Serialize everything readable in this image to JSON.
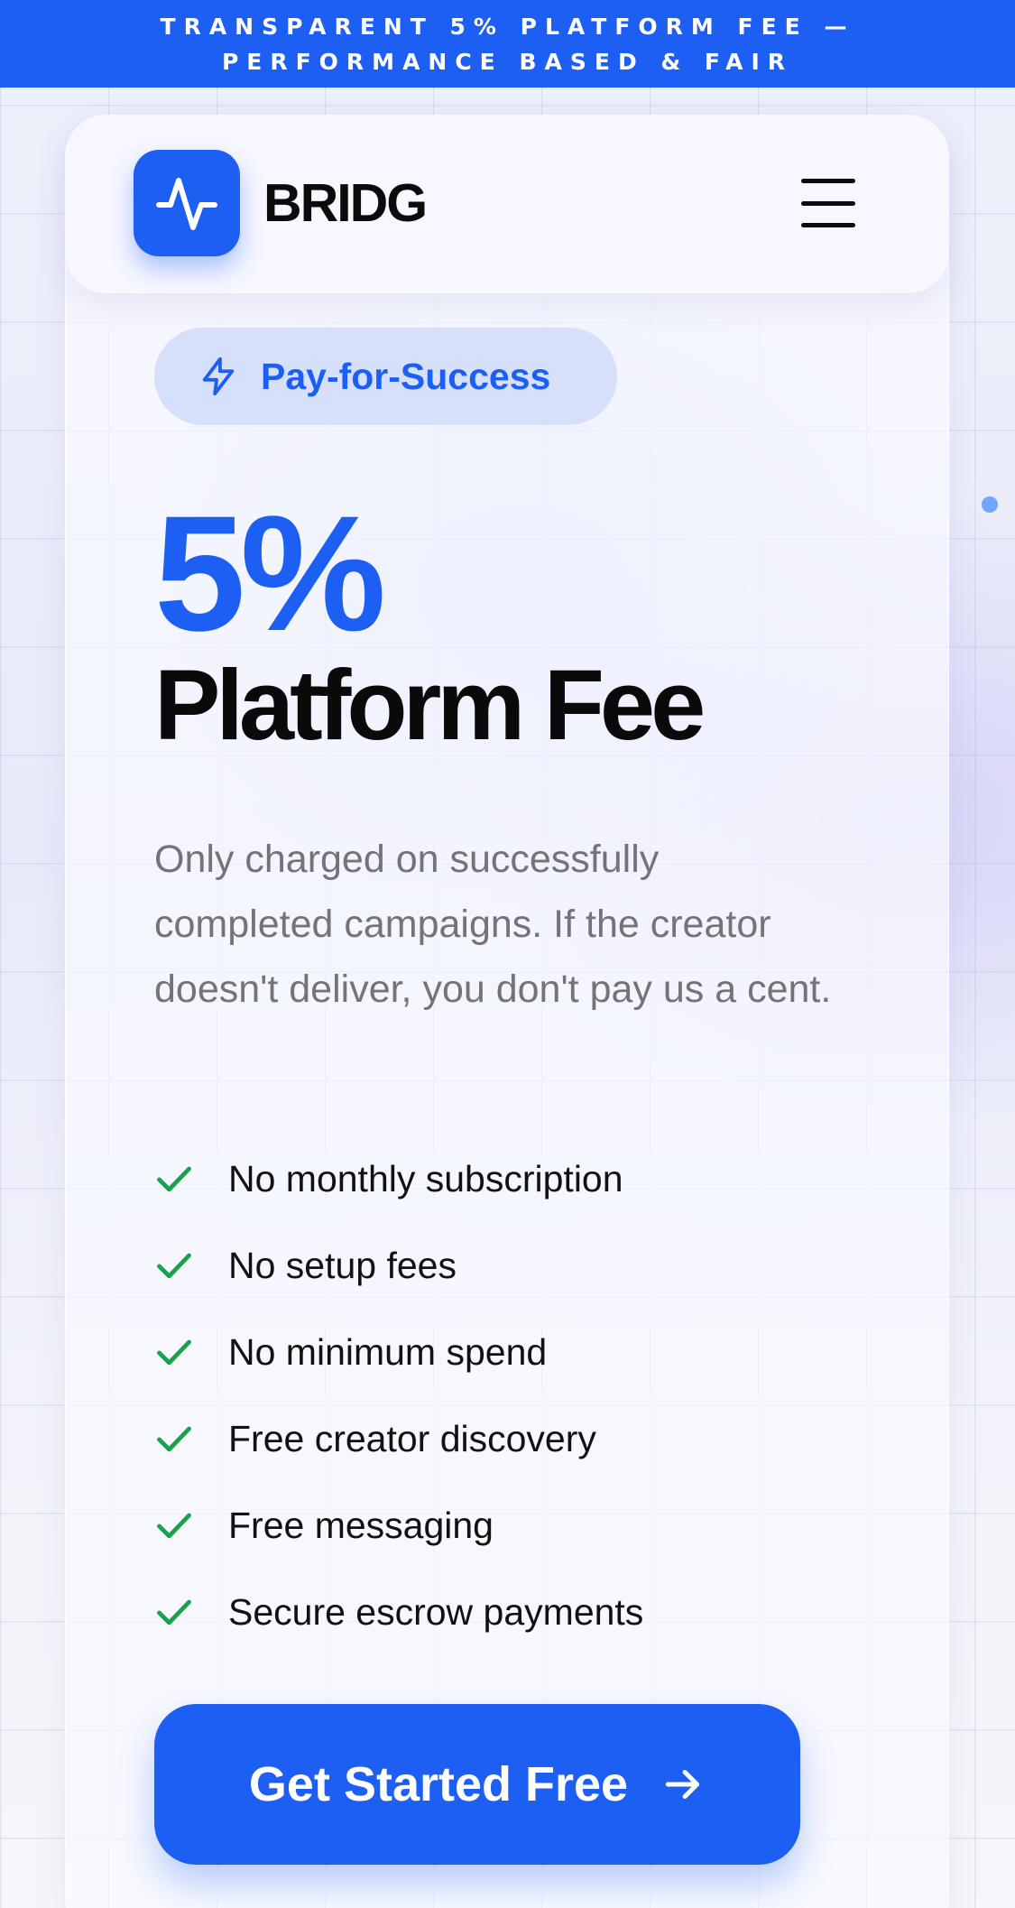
{
  "announcement": {
    "text": "TRANSPARENT 5% PLATFORM FEE — PERFORMANCE BASED & FAIR"
  },
  "header": {
    "brand": "BRIDG",
    "logo_icon": "pulse-icon",
    "menu_icon": "hamburger-menu-icon"
  },
  "badge": {
    "icon": "lightning-icon",
    "label": "Pay-for-Success"
  },
  "hero": {
    "percent": "5%",
    "title": "Platform Fee",
    "description": "Only charged on successfully completed campaigns. If the creator doesn't deliver, you don't pay us a cent."
  },
  "features": [
    {
      "label": "No monthly subscription",
      "icon": "check-icon"
    },
    {
      "label": "No setup fees",
      "icon": "check-icon"
    },
    {
      "label": "No minimum spend",
      "icon": "check-icon"
    },
    {
      "label": "Free creator discovery",
      "icon": "check-icon"
    },
    {
      "label": "Free messaging",
      "icon": "check-icon"
    },
    {
      "label": "Secure escrow payments",
      "icon": "check-icon"
    }
  ],
  "cta": {
    "label": "Get Started Free",
    "icon": "arrow-right-icon"
  },
  "colors": {
    "accent": "#1d5ff3",
    "check": "#16a34a",
    "badge_bg": "#d6e0fb",
    "text_muted": "#737378"
  }
}
